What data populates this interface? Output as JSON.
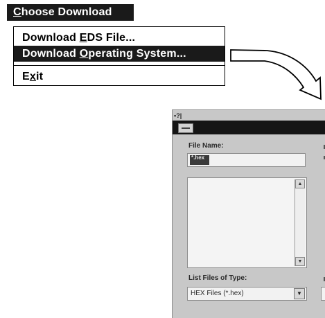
{
  "menu": {
    "title_pre": "",
    "title_ul": "C",
    "title_post": "hoose Download",
    "items": [
      {
        "pre": "Download ",
        "ul": "E",
        "post": "DS File..."
      },
      {
        "pre": "Download ",
        "ul": "O",
        "post": "perating System..."
      },
      {
        "pre": "E",
        "ul": "x",
        "post": "it"
      }
    ]
  },
  "dialog": {
    "window_icon": "▪?|",
    "file_name_label": "File Name:",
    "file_name_value": "*.hex",
    "file_type_label": "List Files of Type:",
    "file_type_value": "HEX Files (*.hex)",
    "scroll_up_glyph": "▲",
    "scroll_down_glyph": "▼",
    "dropdown_glyph": "▼"
  },
  "colors": {
    "menu_bg": "#1a1a1a",
    "dialog_bg": "#c8c8c8",
    "titlebar": "#151515"
  }
}
